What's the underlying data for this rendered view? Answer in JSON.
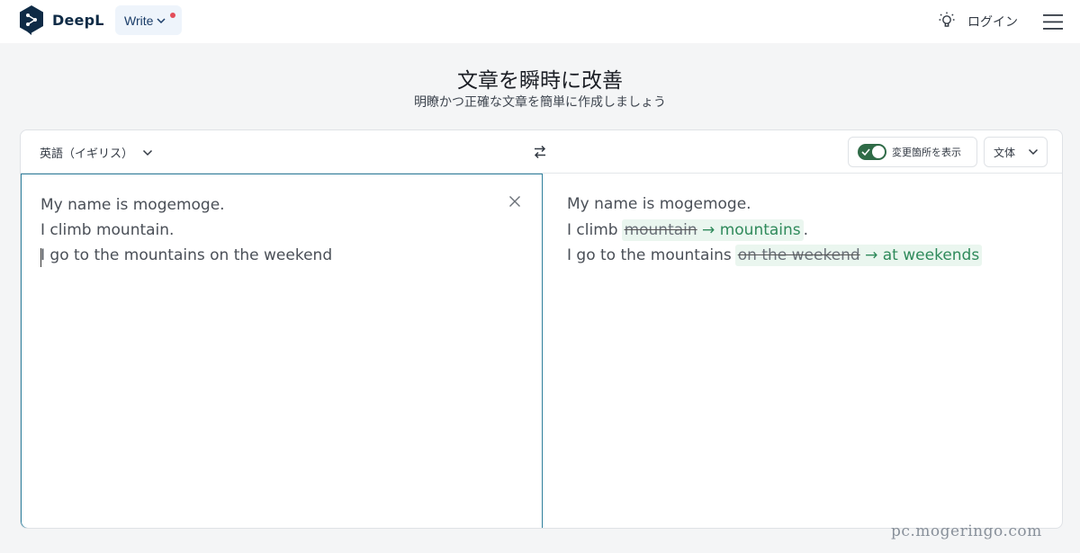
{
  "header": {
    "brand": "DeepL",
    "write_menu": "Write",
    "login": "ログイン",
    "icons": {
      "logo": "deepl-logo",
      "write_chevron": "chevron-down-icon",
      "notification": "notification-dot",
      "theme": "lightbulb-icon",
      "menu": "hamburger-menu-icon"
    },
    "colors": {
      "brand": "#0f2b46",
      "notification": "#e34d59"
    }
  },
  "hero": {
    "title": "文章を瞬時に改善",
    "subtitle": "明瞭かつ正確な文章を簡単に作成しましょう"
  },
  "toolbar": {
    "language": "英語（イギリス）",
    "show_changes_label": "変更箇所を表示",
    "show_changes_on": true,
    "style_label": "文体",
    "icons": {
      "language": "chevron-down-icon",
      "swap": "swap-arrows-icon",
      "style": "chevron-down-icon"
    },
    "colors": {
      "toggle_on": "#2f6b47"
    }
  },
  "input": {
    "lines": [
      "My name is mogemoge.",
      "I climb mountain.",
      "I go to the mountains on the weekend"
    ],
    "clear_icon": "close-icon"
  },
  "output": {
    "line1": "My name is mogemoge.",
    "line2": {
      "before": "I climb",
      "old": "mountain",
      "arrow": " → ",
      "new": "mountains",
      "after": "."
    },
    "line3": {
      "before": "I go to the mountains",
      "old": "on the weekend",
      "arrow": " → ",
      "new": "at weekends"
    },
    "colors": {
      "change_background": "#eaf6ef",
      "change_text": "#2f8a5b"
    }
  },
  "watermark": "pc.mogeringo.com"
}
